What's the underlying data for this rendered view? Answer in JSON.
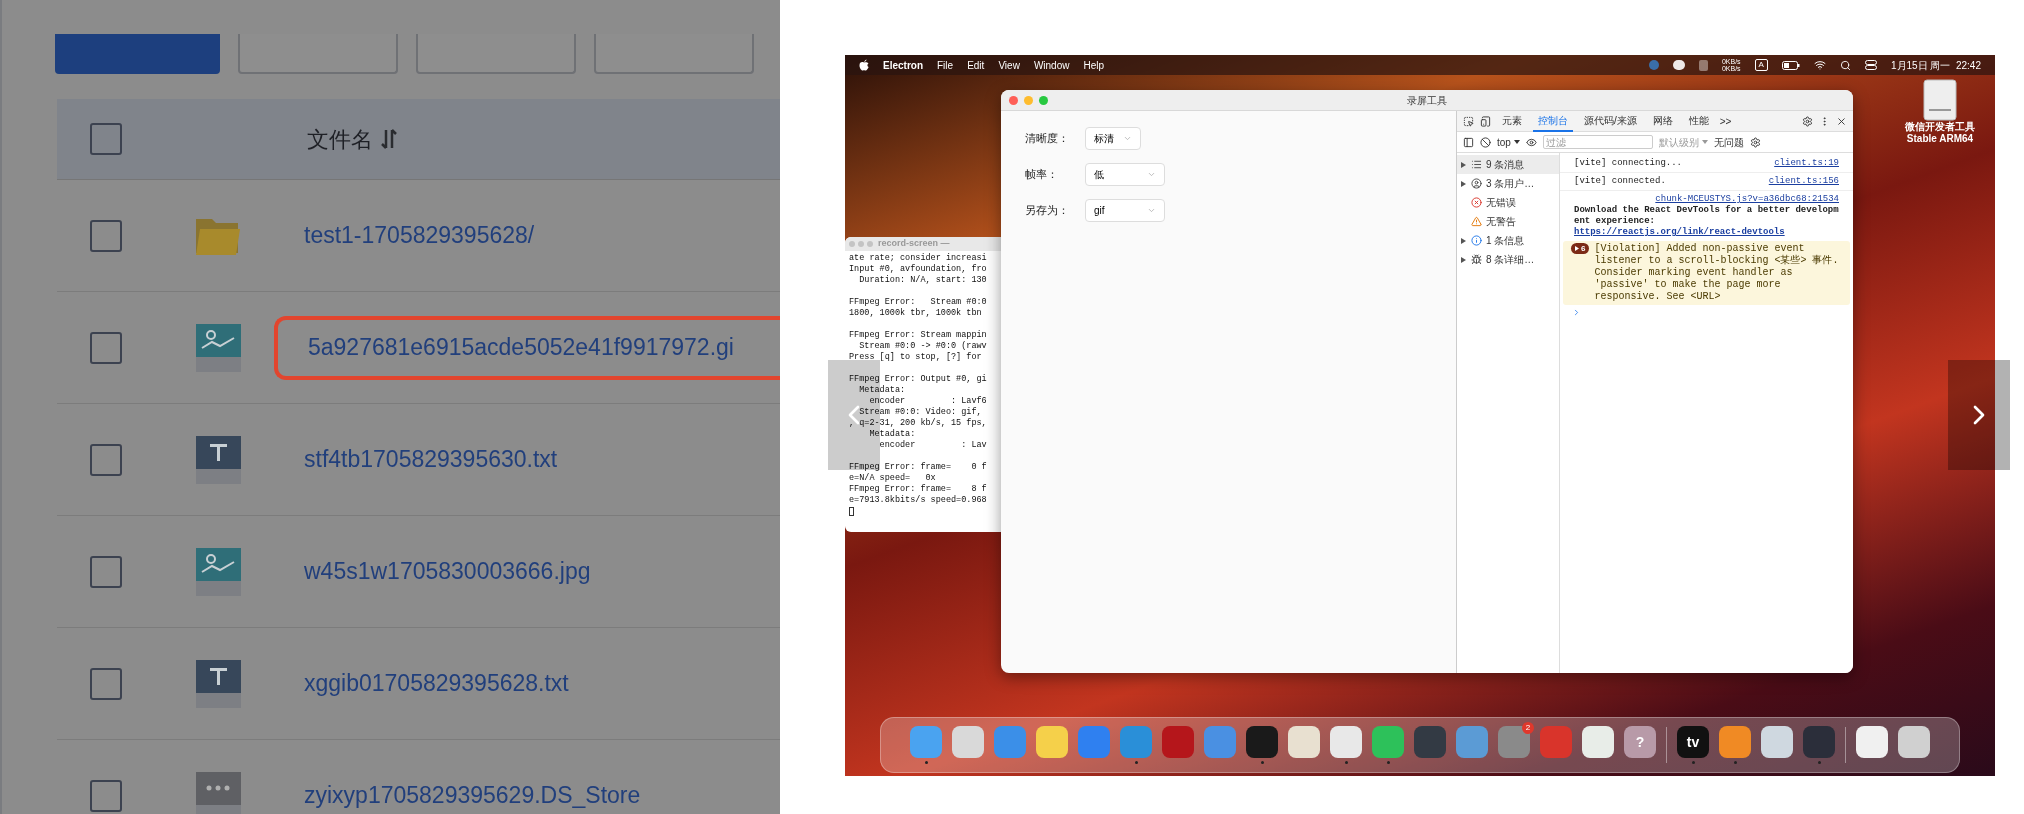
{
  "file_manager": {
    "toolbar_buttons": [
      {
        "kind": "primary"
      },
      {
        "kind": "default"
      },
      {
        "kind": "default"
      },
      {
        "kind": "default"
      }
    ],
    "table": {
      "header": {
        "label": "文件名",
        "checked": false
      },
      "rows": [
        {
          "name": "test1-1705829395628/",
          "kind": "folder",
          "checked": false,
          "highlighted": false
        },
        {
          "name": "5a927681e6915acde5052e41f9917972.gi",
          "kind": "image",
          "checked": false,
          "highlighted": true
        },
        {
          "name": "stf4tb1705829395630.txt",
          "kind": "text",
          "checked": false,
          "highlighted": false
        },
        {
          "name": "w45s1w1705830003666.jpg",
          "kind": "image",
          "checked": false,
          "highlighted": false
        },
        {
          "name": "xggib01705829395628.txt",
          "kind": "text",
          "checked": false,
          "highlighted": false
        },
        {
          "name": "zyixyp1705829395629.DS_Store",
          "kind": "other",
          "checked": false,
          "highlighted": false
        }
      ]
    }
  },
  "viewer": {
    "screenshot": {
      "menu_bar": {
        "app": "Electron",
        "menus": [
          "File",
          "Edit",
          "View",
          "Window",
          "Help"
        ],
        "net_speed": [
          "0KB/s",
          "0KB/s"
        ],
        "input_source": "A",
        "clock": "1月15日 周一  22:42"
      },
      "desktop_icon": {
        "lines": [
          "微信开发者工具",
          "Stable ARM64"
        ]
      },
      "terminal": {
        "title": "record-screen —",
        "blocks": [
          [
            "ate rate; consider increasi",
            "Input #0, avfoundation, fro",
            "  Duration: N/A, start: 130"
          ],
          [
            "FFmpeg Error:   Stream #0:0",
            "1800, 1000k tbr, 1000k tbn"
          ],
          [
            "FFmpeg Error: Stream mappin",
            "  Stream #0:0 -> #0:0 (rawv",
            "Press [q] to stop, [?] for"
          ],
          [
            "FFmpeg Error: Output #0, gi",
            "  Metadata:",
            "    encoder         : Lavf6",
            "  Stream #0:0: Video: gif,",
            ", q=2-31, 200 kb/s, 15 fps,",
            "    Metadata:",
            "      encoder         : Lav"
          ],
          [
            "FFmpeg Error: frame=    0 f",
            "e=N/A speed=   0x",
            "FFmpeg Error: frame=    8 f",
            "e=7913.8kbits/s speed=0.968"
          ]
        ]
      },
      "recorder": {
        "title": "录屏工具",
        "fields": [
          {
            "label": "清晰度：",
            "value": "标清"
          },
          {
            "label": "帧率：",
            "value": "低"
          },
          {
            "label": "另存为：",
            "value": "gif"
          }
        ],
        "devtools": {
          "tabs": [
            {
              "label": "元素",
              "selected": false
            },
            {
              "label": "控制台",
              "selected": true
            },
            {
              "label": "源代码/来源",
              "selected": false
            },
            {
              "label": "网络",
              "selected": false
            },
            {
              "label": "性能",
              "selected": false
            }
          ],
          "more": ">>",
          "context": "top",
          "filter_placeholder": "过滤",
          "levels": "默认级别",
          "issues": "无问题",
          "sidebar": [
            {
              "label": "9 条消息",
              "kind": "messages",
              "expandable": true,
              "selected": true
            },
            {
              "label": "3 条用户…",
              "kind": "user",
              "expandable": true,
              "selected": false
            },
            {
              "label": "无错误",
              "kind": "error",
              "expandable": false,
              "selected": false
            },
            {
              "label": "无警告",
              "kind": "warning",
              "expandable": false,
              "selected": false
            },
            {
              "label": "1 条信息",
              "kind": "info",
              "expandable": true,
              "selected": false
            },
            {
              "label": "8 条详细…",
              "kind": "verbose",
              "expandable": true,
              "selected": false
            }
          ],
          "messages": [
            {
              "kind": "log",
              "text": "[vite] connecting...",
              "source": "client.ts:19"
            },
            {
              "kind": "log",
              "text": "[vite] connected.",
              "source": "client.ts:156"
            },
            {
              "kind": "info",
              "source": "chunk-MCEUSTYS.js?v=a36dbc68:21534",
              "text": "Download the React DevTools for a better development experience: ",
              "link": "https://reactjs.org/link/react-devtools"
            },
            {
              "kind": "violation",
              "count": "6",
              "text": "[Violation] Added non-passive event listener to a scroll-blocking <某些> 事件. Consider marking event handler as 'passive' to make the page more responsive. See <URL>"
            }
          ]
        }
      },
      "dock": {
        "groups": [
          [
            {
              "color": "#4aa3f0",
              "running": true
            },
            {
              "color": "#d9d9d9",
              "running": false
            },
            {
              "color": "#3b8fe8",
              "running": false
            },
            {
              "color": "#f5d04a",
              "running": false
            },
            {
              "color": "#2f80f0",
              "running": false
            },
            {
              "color": "#2a8fd8",
              "running": true
            },
            {
              "color": "#b5161b",
              "running": false
            },
            {
              "color": "#4a90e2",
              "running": false
            },
            {
              "color": "#1a1a1a",
              "running": true
            },
            {
              "color": "#e8e0d0",
              "running": false
            },
            {
              "color": "#e8e8e8",
              "running": true
            },
            {
              "color": "#2dc15a",
              "running": true
            },
            {
              "color": "#333a44",
              "running": false
            },
            {
              "color": "#5b9bd5",
              "running": false
            },
            {
              "color": "#8a8a8a",
              "running": false,
              "badge": "2"
            },
            {
              "color": "#d9342b",
              "running": false
            },
            {
              "color": "#e8ede8",
              "running": false
            },
            {
              "color": "#b89aa8",
              "running": false,
              "glyph": "?"
            }
          ],
          [
            {
              "color": "#111111",
              "running": true,
              "glyph": "tv"
            },
            {
              "color": "#f08a24",
              "running": true
            },
            {
              "color": "#cfd8e0",
              "running": false
            },
            {
              "color": "#2b2e3a",
              "running": true
            }
          ],
          [
            {
              "color": "#f0f0f0",
              "running": false
            },
            {
              "color": "#d0d0d0",
              "running": false
            }
          ]
        ]
      }
    }
  }
}
